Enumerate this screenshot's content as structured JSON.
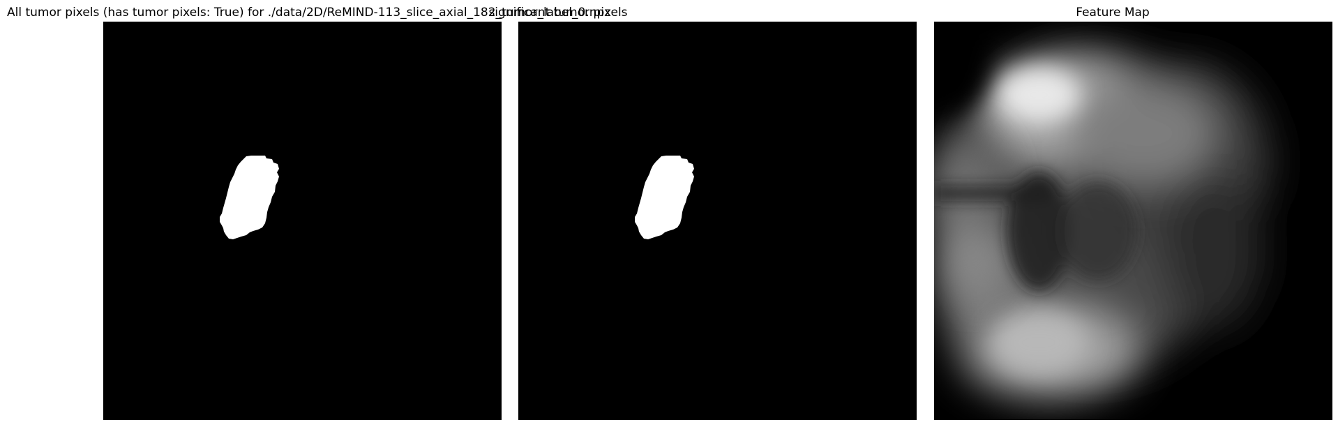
{
  "panels": [
    {
      "title": "All tumor pixels (has tumor pixels: True) for ./data/2D/ReMIND-113_slice_axial_182_tumor_label_0.npz",
      "kind": "binary-mask"
    },
    {
      "title": "significant tumor pixels",
      "kind": "binary-mask"
    },
    {
      "title": "Feature Map",
      "kind": "grayscale-heatmap"
    }
  ],
  "colors": {
    "background": "#ffffff",
    "image_background": "#000000",
    "mask_foreground": "#ffffff"
  }
}
